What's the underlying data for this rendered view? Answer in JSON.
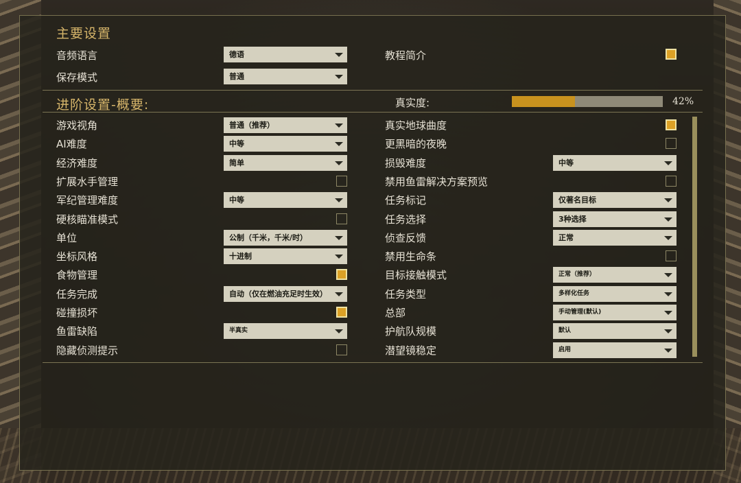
{
  "main_settings": {
    "title": "主要设置",
    "audio_language": {
      "label": "音频语言",
      "value": "德语"
    },
    "save_mode": {
      "label": "保存模式",
      "value": "普通"
    },
    "tutorial": {
      "label": "教程简介",
      "checked": true
    }
  },
  "advanced": {
    "title": "进阶设置-概要:",
    "realism_label": "真实度:",
    "realism_percent": 42,
    "realism_text": "42%",
    "left": [
      {
        "label": "游戏视角",
        "type": "dropdown",
        "value": "普通（推荐）"
      },
      {
        "label": "AI难度",
        "type": "dropdown",
        "value": "中等"
      },
      {
        "label": "经济难度",
        "type": "dropdown",
        "value": "简单"
      },
      {
        "label": "扩展水手管理",
        "type": "checkbox",
        "checked": false
      },
      {
        "label": "军纪管理难度",
        "type": "dropdown",
        "value": "中等"
      },
      {
        "label": "硬核瞄准模式",
        "type": "checkbox",
        "checked": false
      },
      {
        "label": "单位",
        "type": "dropdown",
        "value": "公制（千米，千米/时）"
      },
      {
        "label": "坐标风格",
        "type": "dropdown",
        "value": "十进制"
      },
      {
        "label": "食物管理",
        "type": "checkbox",
        "checked": true
      },
      {
        "label": "任务完成",
        "type": "dropdown",
        "value": "自动（仅在燃油充足时生效）"
      },
      {
        "label": "碰撞损坏",
        "type": "checkbox",
        "checked": true
      },
      {
        "label": "鱼雷缺陷",
        "type": "dropdown",
        "value": "半真实",
        "small": true
      },
      {
        "label": "隐藏侦测提示",
        "type": "checkbox",
        "checked": false
      }
    ],
    "right": [
      {
        "label": "真实地球曲度",
        "type": "checkbox",
        "checked": true
      },
      {
        "label": "更黑暗的夜晚",
        "type": "checkbox",
        "checked": false
      },
      {
        "label": "损毁难度",
        "type": "dropdown",
        "value": "中等"
      },
      {
        "label": "禁用鱼雷解决方案预览",
        "type": "checkbox",
        "checked": false
      },
      {
        "label": "任务标记",
        "type": "dropdown",
        "value": "仅著名目标"
      },
      {
        "label": "任务选择",
        "type": "dropdown",
        "value": "3种选择"
      },
      {
        "label": "侦查反馈",
        "type": "dropdown",
        "value": "正常"
      },
      {
        "label": "禁用生命条",
        "type": "checkbox",
        "checked": false
      },
      {
        "label": "目标接触模式",
        "type": "dropdown",
        "value": "正常（推荐）",
        "small": true
      },
      {
        "label": "任务类型",
        "type": "dropdown",
        "value": "多样化任务",
        "small": true
      },
      {
        "label": "总部",
        "type": "dropdown",
        "value": "手动管理(默认)",
        "small": true
      },
      {
        "label": "护航队规模",
        "type": "dropdown",
        "value": "默认",
        "small": true
      },
      {
        "label": "潜望镜稳定",
        "type": "dropdown",
        "value": "启用",
        "small": true
      }
    ]
  },
  "colors": {
    "accent_gold": "#dca126",
    "title_gold": "#d6b56a",
    "dropdown_bg": "#d5d1bf"
  }
}
